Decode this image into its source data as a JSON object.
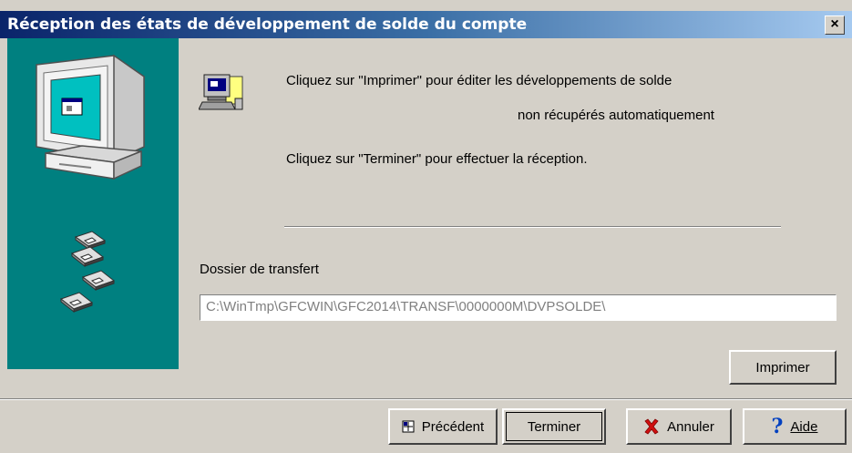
{
  "window": {
    "title": "Réception des états de développement de solde du compte",
    "close_glyph": "×"
  },
  "icons": {
    "computer": "computer-monitor-icon",
    "disks": "floppy-disks-icon",
    "print": "print-computer-icon",
    "previous": "previous-arrow-icon",
    "cancel": "red-x-icon",
    "help": "question-mark-icon"
  },
  "instructions": {
    "line1": "Cliquez sur \"Imprimer\" pour éditer les développements de solde",
    "line2": "non récupérés automatiquement",
    "line3": "Cliquez sur \"Terminer\" pour effectuer la réception."
  },
  "transfer": {
    "label": "Dossier de transfert",
    "path": "C:\\WinTmp\\GFCWIN\\GFC2014\\TRANSF\\0000000M\\DVPSOLDE\\"
  },
  "buttons": {
    "print": "Imprimer",
    "previous": "Précédent",
    "finish": "Terminer",
    "cancel": "Annuler",
    "help": "Aide"
  },
  "colors": {
    "panel": "#008080",
    "title_start": "#0a246a",
    "title_end": "#a6caf0",
    "dialog": "#d4d0c8"
  }
}
